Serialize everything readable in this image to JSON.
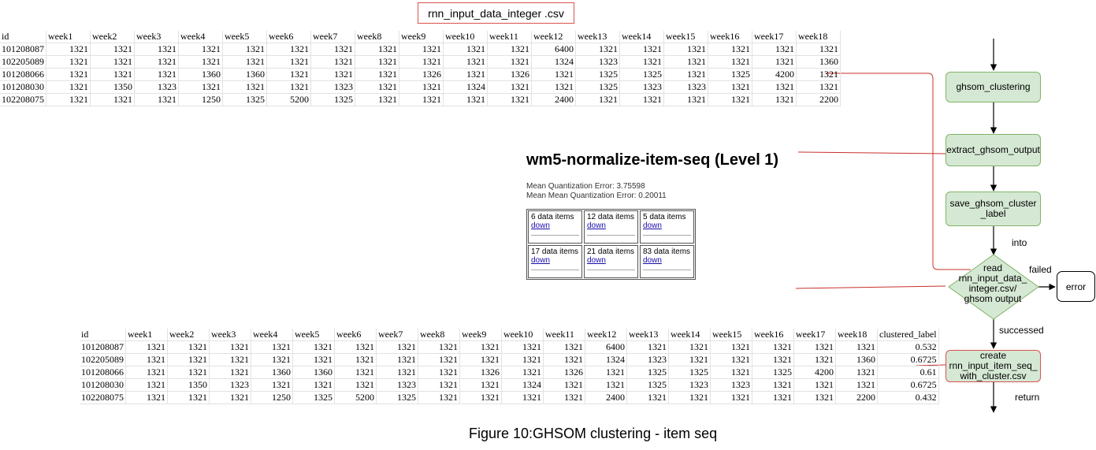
{
  "file_title": "rnn_input_data_integer .csv",
  "table1": {
    "headers": [
      "id",
      "week1",
      "week2",
      "week3",
      "week4",
      "week5",
      "week6",
      "week7",
      "week8",
      "week9",
      "week10",
      "week11",
      "week12",
      "week13",
      "week14",
      "week15",
      "week16",
      "week17",
      "week18"
    ],
    "rows": [
      [
        "101208087",
        "1321",
        "1321",
        "1321",
        "1321",
        "1321",
        "1321",
        "1321",
        "1321",
        "1321",
        "1321",
        "1321",
        "6400",
        "1321",
        "1321",
        "1321",
        "1321",
        "1321",
        "1321"
      ],
      [
        "102205089",
        "1321",
        "1321",
        "1321",
        "1321",
        "1321",
        "1321",
        "1321",
        "1321",
        "1321",
        "1321",
        "1321",
        "1324",
        "1323",
        "1321",
        "1321",
        "1321",
        "1321",
        "1360"
      ],
      [
        "101208066",
        "1321",
        "1321",
        "1321",
        "1360",
        "1360",
        "1321",
        "1321",
        "1321",
        "1326",
        "1321",
        "1326",
        "1321",
        "1325",
        "1325",
        "1321",
        "1325",
        "4200",
        "1321"
      ],
      [
        "101208030",
        "1321",
        "1350",
        "1323",
        "1321",
        "1321",
        "1321",
        "1323",
        "1321",
        "1321",
        "1324",
        "1321",
        "1321",
        "1325",
        "1323",
        "1323",
        "1321",
        "1321",
        "1321"
      ],
      [
        "102208075",
        "1321",
        "1321",
        "1321",
        "1250",
        "1325",
        "5200",
        "1325",
        "1321",
        "1321",
        "1321",
        "1321",
        "2400",
        "1321",
        "1321",
        "1321",
        "1321",
        "1321",
        "2200"
      ]
    ]
  },
  "report": {
    "title": "wm5-normalize-item-seq (Level 1)",
    "mqe": "Mean Quantization Error: 3.75598",
    "mmqe": "Mean Mean Quantization Error: 0.20011",
    "link_label": "down",
    "cells": [
      "6 data items",
      "12 data items",
      "5 data items",
      "17 data items",
      "21 data items",
      "83 data items"
    ]
  },
  "table2": {
    "headers": [
      "id",
      "week1",
      "week2",
      "week3",
      "week4",
      "week5",
      "week6",
      "week7",
      "week8",
      "week9",
      "week10",
      "week11",
      "week12",
      "week13",
      "week14",
      "week15",
      "week16",
      "week17",
      "week18",
      "clustered_label"
    ],
    "rows": [
      [
        "101208087",
        "1321",
        "1321",
        "1321",
        "1321",
        "1321",
        "1321",
        "1321",
        "1321",
        "1321",
        "1321",
        "1321",
        "6400",
        "1321",
        "1321",
        "1321",
        "1321",
        "1321",
        "1321",
        "0.532"
      ],
      [
        "102205089",
        "1321",
        "1321",
        "1321",
        "1321",
        "1321",
        "1321",
        "1321",
        "1321",
        "1321",
        "1321",
        "1321",
        "1324",
        "1323",
        "1321",
        "1321",
        "1321",
        "1321",
        "1360",
        "0.6725"
      ],
      [
        "101208066",
        "1321",
        "1321",
        "1321",
        "1360",
        "1360",
        "1321",
        "1321",
        "1321",
        "1326",
        "1321",
        "1326",
        "1321",
        "1325",
        "1325",
        "1321",
        "1325",
        "4200",
        "1321",
        "0.61"
      ],
      [
        "101208030",
        "1321",
        "1350",
        "1323",
        "1321",
        "1321",
        "1321",
        "1323",
        "1321",
        "1321",
        "1324",
        "1321",
        "1321",
        "1325",
        "1323",
        "1323",
        "1321",
        "1321",
        "1321",
        "0.6725"
      ],
      [
        "102208075",
        "1321",
        "1321",
        "1321",
        "1250",
        "1325",
        "5200",
        "1325",
        "1321",
        "1321",
        "1321",
        "1321",
        "2400",
        "1321",
        "1321",
        "1321",
        "1321",
        "1321",
        "2200",
        "0.432"
      ]
    ]
  },
  "flow": {
    "ghsom_clustering": "ghsom_clustering",
    "extract_ghsom_output": "extract_ghsom_output",
    "save_label_1": "save_ghsom_cluster",
    "save_label_2": "_label",
    "into": "into",
    "read_1": "read",
    "read_2": "rnn_input_data_",
    "read_3": "integer.csv/",
    "read_4": "ghsom output",
    "failed": "failed",
    "error": "error",
    "successed": "successed",
    "create_1": "create",
    "create_2": "rnn_input_item_seq_",
    "create_3": "with_cluster.csv",
    "return": "return"
  },
  "caption": "Figure 10:GHSOM clustering - item seq",
  "colors": {
    "process_fill": "#d5e8d4",
    "process_border": "#82b366",
    "highlight_border": "#d9534f",
    "link": "#1a0dab"
  }
}
